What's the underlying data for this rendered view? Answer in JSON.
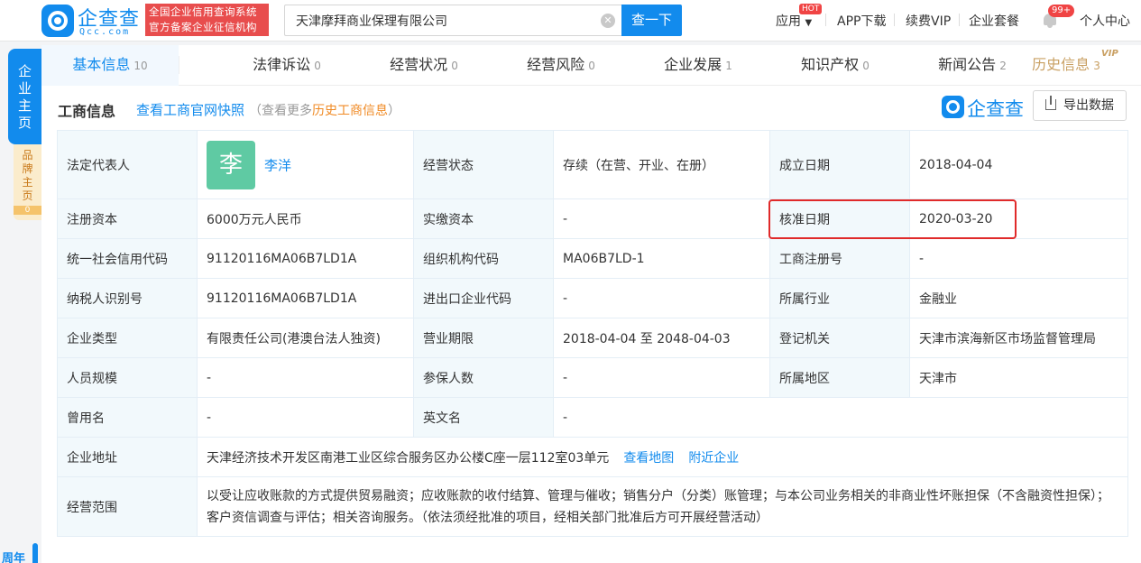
{
  "header": {
    "logo_text": "企查查",
    "logo_sub": "Qcc.com",
    "cert_line1": "全国企业信用查询系统",
    "cert_line2": "官方备案企业征信机构",
    "search_value": "天津摩拜商业保理有限公司",
    "search_button": "查一下",
    "nav": {
      "apply": "应用",
      "hot": "HOT",
      "app_download": "APP下载",
      "renew_vip": "续费VIP",
      "enterprise_package": "企业套餐",
      "badge": "99+",
      "personal_center": "个人中心"
    }
  },
  "side": {
    "main_tab": "企业主页",
    "brand_tab": "品牌主页",
    "brand_count": "0",
    "anniversary": "周年"
  },
  "tabs": [
    {
      "label": "基本信息",
      "count": "10"
    },
    {
      "label": "法律诉讼",
      "count": "0"
    },
    {
      "label": "经营状况",
      "count": "0"
    },
    {
      "label": "经营风险",
      "count": "0"
    },
    {
      "label": "企业发展",
      "count": "1"
    },
    {
      "label": "知识产权",
      "count": "0"
    },
    {
      "label": "新闻公告",
      "count": "2"
    },
    {
      "label": "历史信息",
      "count": "3"
    }
  ],
  "vip_tag": "VIP",
  "section": {
    "title": "工商信息",
    "official_link": "查看工商官网快照",
    "more_prefix": "（查看更多",
    "more_link": "历史工商信息",
    "more_suffix": "）",
    "brand": "企查查",
    "export": "导出数据"
  },
  "info": {
    "legal_rep_label": "法定代表人",
    "legal_rep_avatar": "李",
    "legal_rep_name": "李洋",
    "status_label": "经营状态",
    "status_value": "存续（在营、开业、在册）",
    "founded_label": "成立日期",
    "founded_value": "2018-04-04",
    "reg_capital_label": "注册资本",
    "reg_capital_value": "6000万元人民币",
    "paid_capital_label": "实缴资本",
    "paid_capital_value": "-",
    "approved_label": "核准日期",
    "approved_value": "2020-03-20",
    "credit_code_label": "统一社会信用代码",
    "credit_code_value": "91120116MA06B7LD1A",
    "org_code_label": "组织机构代码",
    "org_code_value": "MA06B7LD-1",
    "reg_no_label": "工商注册号",
    "reg_no_value": "-",
    "taxpayer_label": "纳税人识别号",
    "taxpayer_value": "91120116MA06B7LD1A",
    "import_export_label": "进出口企业代码",
    "import_export_value": "-",
    "industry_label": "所属行业",
    "industry_value": "金融业",
    "type_label": "企业类型",
    "type_value": "有限责任公司(港澳台法人独资)",
    "term_label": "营业期限",
    "term_value": "2018-04-04 至 2048-04-03",
    "authority_label": "登记机关",
    "authority_value": "天津市滨海新区市场监督管理局",
    "staff_label": "人员规模",
    "staff_value": "-",
    "insured_label": "参保人数",
    "insured_value": "-",
    "region_label": "所属地区",
    "region_value": "天津市",
    "former_name_label": "曾用名",
    "former_name_value": "-",
    "english_name_label": "英文名",
    "english_name_value": "-",
    "address_label": "企业地址",
    "address_value": "天津经济技术开发区南港工业区综合服务区办公楼C座一层112室03单元",
    "view_map": "查看地图",
    "nearby": "附近企业",
    "scope_label": "经营范围",
    "scope_value": "以受让应收账款的方式提供贸易融资；应收账款的收付结算、管理与催收；销售分户（分类）账管理；与本公司业务相关的非商业性坏账担保（不含融资性担保）；客户资信调查与评估；相关咨询服务。（依法须经批准的项目，经相关部门批准后方可开展经营活动）"
  }
}
